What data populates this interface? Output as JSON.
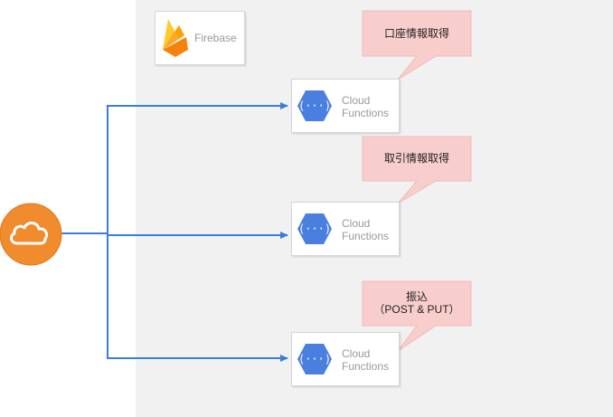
{
  "diagram": {
    "firebase": {
      "label": "Firebase",
      "icon": "firebase-icon"
    },
    "client": {
      "icon": "cloud-icon",
      "color": "#f08b2e"
    },
    "functions": [
      {
        "line1": "Cloud",
        "line2": "Functions",
        "icon": "cloud-functions-icon"
      },
      {
        "line1": "Cloud",
        "line2": "Functions",
        "icon": "cloud-functions-icon"
      },
      {
        "line1": "Cloud",
        "line2": "Functions",
        "icon": "cloud-functions-icon"
      }
    ],
    "callouts": [
      {
        "line1": "口座情報取得",
        "line2": ""
      },
      {
        "line1": "取引情報取得",
        "line2": ""
      },
      {
        "line1": "振込",
        "line2": "（POST & PUT）"
      }
    ],
    "colors": {
      "connector": "#3b7ddd",
      "callout_fill": "#f8cecc",
      "panel": "#f1f1f1",
      "functions_blue": "#4a7fe0"
    }
  }
}
